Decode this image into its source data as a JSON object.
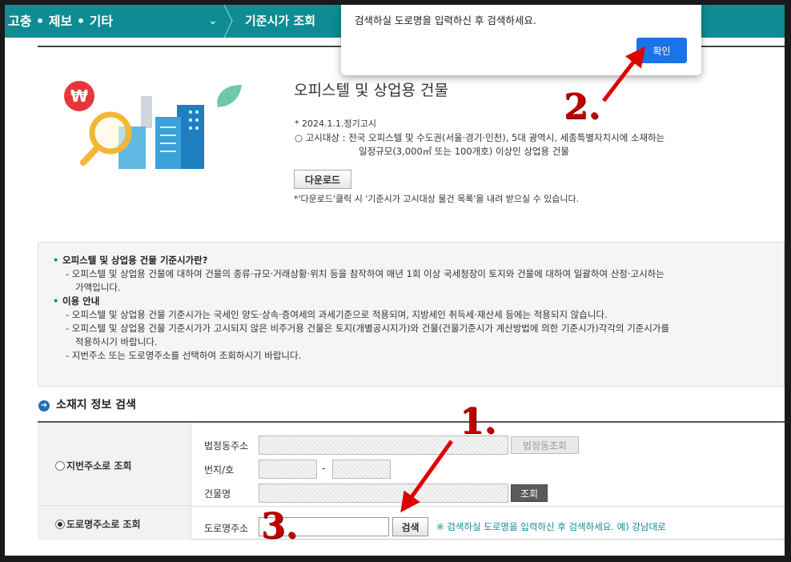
{
  "nav": {
    "crumb1": "고충 • 제보 • 기타",
    "crumb2": "기준시가 조회"
  },
  "hero": {
    "title": "오피스텔 및 상업용 건물",
    "date": "* 2024.1.1.정기고시",
    "target_line1": "○ 고시대상 : 전국 오피스텔 및 수도권(서울·경기·인천), 5대 광역시, 세종특별자치시에 소재하는",
    "target_line2": "일정규모(3,000㎡ 또는 100개호) 이상인 상업용 건물",
    "download_label": "다운로드",
    "download_note": "*'다운로드'클릭 시 '기준시가 고시대상 물건 목록'을 내려 받으실 수 있습니다."
  },
  "info": {
    "heading1": "오피스텔 및 상업용 건물 기준시가란?",
    "desc1a": "- 오피스텔 및 상업용 건물에 대하여 건물의 종류·규모·거래상황·위치 등을 참작하여 매년 1회 이상 국세청장이 토지와 건물에 대하여 일괄하여 산정·고시하는",
    "desc1b": "가액입니다.",
    "heading2": "이용 안내",
    "item1": "- 오피스텔 및 상업용 건물 기준시가는 국세인 양도·상속·증여세의 과세기준으로 적용되며, 지방세인 취득세·재산세 등에는 적용되지 않습니다.",
    "item2a": "- 오피스텔 및 상업용 건물 기준시가가 고시되지 않은 비주거용 건물은 토지(개별공시지가)와 건물(건물기준시가 계산방법에 의한 기준시가)각각의 기준시가를",
    "item2b": "적용하시기 바랍니다.",
    "item3": "- 지번주소 또는 도로명주소를 선택하여 조회하시기 바랍니다."
  },
  "search": {
    "section_title": "소재지 정보 검색",
    "lot_radio": "지번주소로 조회",
    "road_radio": "도로명주소로 조회",
    "legal_dong_label": "법정동주소",
    "legal_dong_btn": "법정동조회",
    "lot_no_label": "번지/호",
    "lot_dash": "-",
    "building_label": "건물명",
    "query_btn": "조회",
    "road_label": "도로명주소",
    "road_value": "",
    "search_btn": "검색",
    "hint": "※ 검색하실 도로명을 입력하신 후 검색하세요. 예) 강남대로"
  },
  "dialog": {
    "message": "검색하실 도로명을 입력하신 후 검색하세요.",
    "ok_label": "확인"
  },
  "annotations": {
    "one": "1.",
    "two": "2.",
    "three": "3.",
    "color": "#c00000"
  }
}
